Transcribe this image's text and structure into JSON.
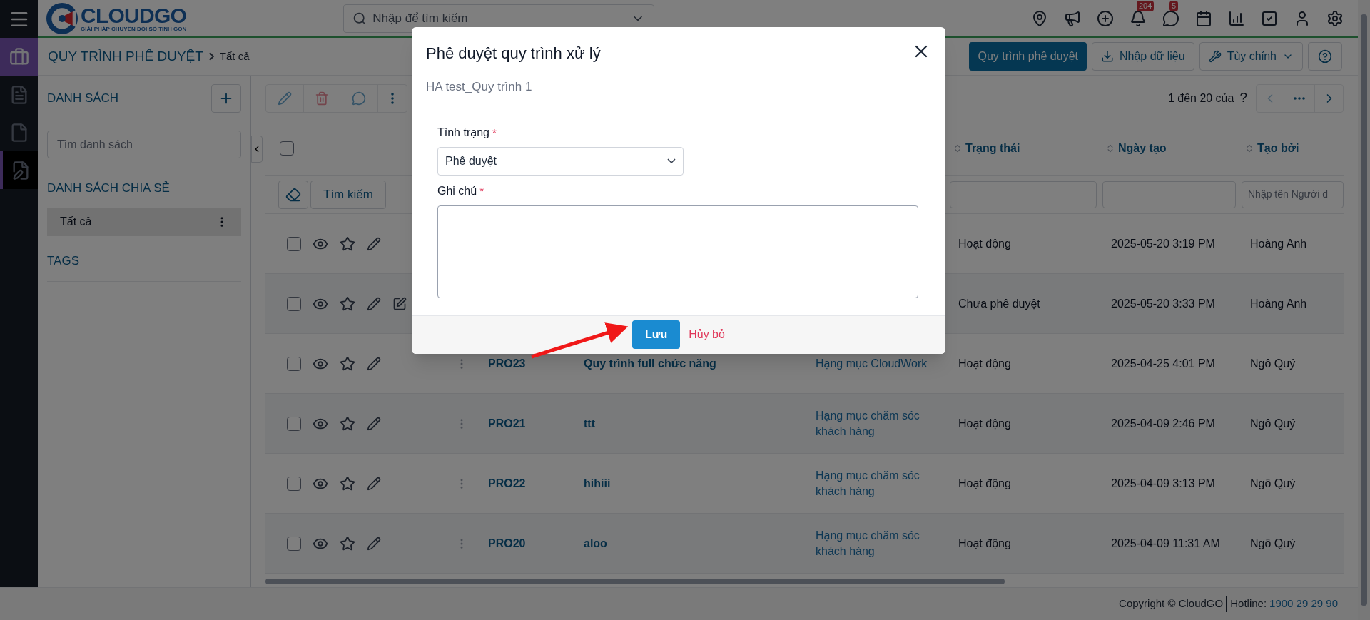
{
  "header": {
    "logo": {
      "name": "CLOUDGO",
      "tagline": "GIẢI PHÁP CHUYỂN ĐỔI SỐ TINH GỌN"
    },
    "search": {
      "placeholder": "Nhập để tìm kiếm"
    },
    "icons": [
      {
        "kind": "pin"
      },
      {
        "kind": "megaphone"
      },
      {
        "kind": "plus"
      },
      {
        "kind": "bell",
        "badge": "204"
      },
      {
        "kind": "chat",
        "badge": "5"
      },
      {
        "kind": "calendar"
      },
      {
        "kind": "chart"
      },
      {
        "kind": "task"
      },
      {
        "kind": "user"
      },
      {
        "kind": "settings"
      }
    ]
  },
  "rail": [
    {
      "kind": "module",
      "selected": true
    },
    {
      "kind": "signed-doc",
      "selected": false
    },
    {
      "kind": "doc",
      "selected": false
    },
    {
      "kind": "sign-edit",
      "selected": true
    }
  ],
  "breadcrumb": {
    "module": "QUY TRÌNH PHÊ DUYỆT",
    "current": "Tất cả"
  },
  "actions": [
    {
      "kind": "primary",
      "label": "Quy trình phê duyệt"
    },
    {
      "kind": "import",
      "label": "Nhập dữ liệu"
    },
    {
      "kind": "customize",
      "label": "Tùy chỉnh"
    },
    {
      "kind": "help"
    }
  ],
  "sidebar": {
    "lists_title": "DANH SÁCH",
    "search": {
      "placeholder": "Tìm danh sách"
    },
    "shared_title": "DANH SÁCH CHIA SẺ",
    "shared_items": [
      {
        "label": "Tất cả",
        "selected": true
      }
    ],
    "tags_title": "TAGS"
  },
  "pagination": {
    "range": "1 đến 20 của",
    "total": "?"
  },
  "table": {
    "all_checked": false,
    "columns": [
      {
        "label": "Trạng thái"
      },
      {
        "label": "Ngày tạo"
      },
      {
        "label": "Tạo bởi"
      }
    ],
    "filter": {
      "search_button": "Tìm kiếm",
      "creator_placeholder": "Nhập tên Người d"
    },
    "rows": [
      {
        "checked": false,
        "quick_edit": false,
        "status": "Hoạt động",
        "created": "2025-05-20 3:19 PM",
        "creator": "Hoàng Anh"
      },
      {
        "checked": false,
        "quick_edit": true,
        "status": "Chưa phê duyệt",
        "created": "2025-05-20 3:33 PM",
        "creator": "Hoàng Anh"
      },
      {
        "checked": false,
        "quick_edit": false,
        "code": "PRO23",
        "name": "Quy trình full chức năng",
        "category": "Hạng mục CloudWork",
        "status": "Hoạt động",
        "created": "2025-04-25 4:01 PM",
        "creator": "Ngô Quý"
      },
      {
        "checked": false,
        "quick_edit": false,
        "code": "PRO21",
        "name": "ttt",
        "category": "Hạng mục chăm sóc khách hàng",
        "status": "Hoạt động",
        "created": "2025-04-09 2:46 PM",
        "creator": "Ngô Quý"
      },
      {
        "checked": false,
        "quick_edit": false,
        "code": "PRO22",
        "name": "hihiii",
        "category": "Hạng mục chăm sóc khách hàng",
        "status": "Hoạt động",
        "created": "2025-04-09 3:13 PM",
        "creator": "Ngô Quý"
      },
      {
        "checked": false,
        "quick_edit": false,
        "code": "PRO20",
        "name": "aloo",
        "category": "Hạng mục chăm sóc khách hàng",
        "status": "Hoạt động",
        "created": "2025-04-09 11:31 AM",
        "creator": "Ngô Quý"
      }
    ]
  },
  "footer": {
    "copyright": "Copyright © CloudGO",
    "hotline_label": "Hotline:",
    "hotline": "1900 29 29 90"
  },
  "dialog": {
    "title": "Phê duyệt quy trình xử lý",
    "subtitle": "HA test_Quy trình 1",
    "fields": [
      {
        "kind": "select",
        "label": "Tình trạng",
        "mark": "*",
        "value": "Phê duyệt"
      },
      {
        "kind": "textarea",
        "label": "Ghi chú",
        "mark": "*"
      }
    ],
    "buttons": [
      {
        "kind": "primary",
        "label": "Lưu"
      },
      {
        "kind": "link",
        "label": "Hủy bỏ"
      }
    ]
  }
}
